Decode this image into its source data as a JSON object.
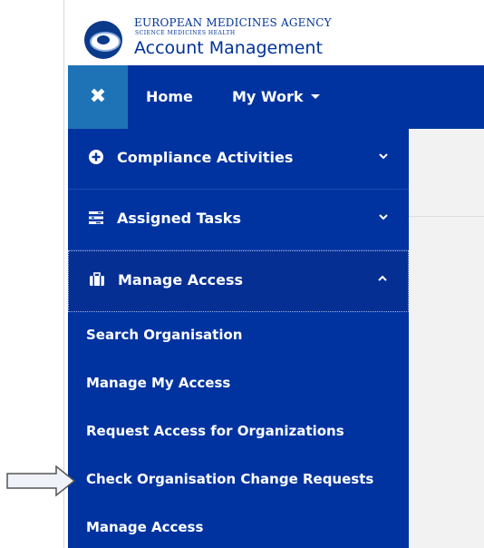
{
  "brand": {
    "agency": "EUROPEAN MEDICINES AGENCY",
    "tagline": "SCIENCE   MEDICINES   HEALTH",
    "app_title": "Account Management"
  },
  "topnav": {
    "close_glyph": "✖",
    "home": "Home",
    "my_work": "My Work"
  },
  "sidebar": {
    "sections": [
      {
        "label": "Compliance Activities",
        "icon": "plus-circle-icon",
        "chevron": "⌄"
      },
      {
        "label": "Assigned Tasks",
        "icon": "tasks-icon",
        "chevron": "⌄"
      },
      {
        "label": "Manage Access",
        "icon": "briefcase-icon",
        "chevron": "^"
      }
    ],
    "submenu": [
      "Search Organisation",
      "Manage My Access",
      "Request Access for Organizations",
      "Check Organisation Change Requests",
      "Manage Access"
    ]
  },
  "colors": {
    "nav_blue": "#0033a0",
    "close_box": "#1e73b7",
    "brand_blue": "#003399"
  }
}
